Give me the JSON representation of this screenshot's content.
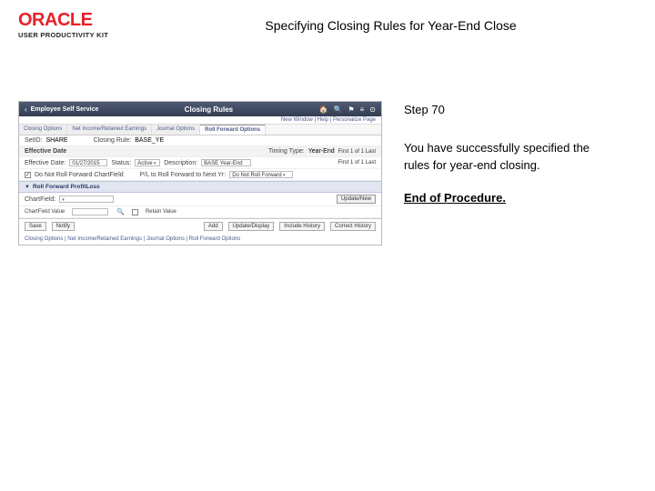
{
  "header": {
    "brand": "ORACLE",
    "product": "USER PRODUCTIVITY KIT",
    "title": "Specifying Closing Rules for Year-End Close"
  },
  "info": {
    "step": "Step 70",
    "desc": "You have successfully specified the rules for year-end closing.",
    "end": "End of Procedure."
  },
  "app": {
    "topbar": {
      "back": "‹",
      "left": "Employee Self Service",
      "center": "Closing Rules",
      "icons": [
        "🏠",
        "🔍",
        "⚑",
        "≡",
        "⊙"
      ]
    },
    "subbar": "New Window | Help | Personalize Page",
    "tabs": [
      "Closing Options",
      "Net Income/Retained Earnings",
      "Journal Options",
      "Roll Forward Options"
    ],
    "active_tab": 3,
    "row1": {
      "setid_lbl": "SetID:",
      "setid_val": "SHARE",
      "rule_lbl": "Closing Rule:",
      "rule_val": "BASE_YE"
    },
    "row2": {
      "eff_lbl": "Effective Date",
      "timing_lbl": "Timing Type:",
      "timing_val": "Year-End",
      "pager": "First  1 of 1  Last"
    },
    "row3": {
      "date_lbl": "Effective Date:",
      "date_val": "01/27/2015",
      "status_lbl": "Status:",
      "status_val": "Active",
      "desc_lbl": "Description:",
      "desc_val": "BASE Year-End",
      "pager": "First  1 of 1  Last"
    },
    "row4": {
      "chk1_lbl": "Do Not Roll Forward ChartField",
      "pl_lbl": "P/L to Roll Forward to Next Yr:",
      "pl_val": "Do Not Roll Forward"
    },
    "section": "Roll Forward ProfitLoss",
    "row5": {
      "cf_lbl": "ChartField:",
      "cf_val": "",
      "update_btn": "Update/New"
    },
    "sub": {
      "cfval_lbl": "ChartField Value",
      "retain_lbl": "Retain Value"
    },
    "footer": {
      "save": "Save",
      "notify": "Notify",
      "add": "Add",
      "upd": "Update/Display",
      "inc": "Include History",
      "corr": "Correct History"
    },
    "breadcrumb": "Closing Options | Net Income/Retained Earnings | Journal Options | Roll Forward Options"
  }
}
